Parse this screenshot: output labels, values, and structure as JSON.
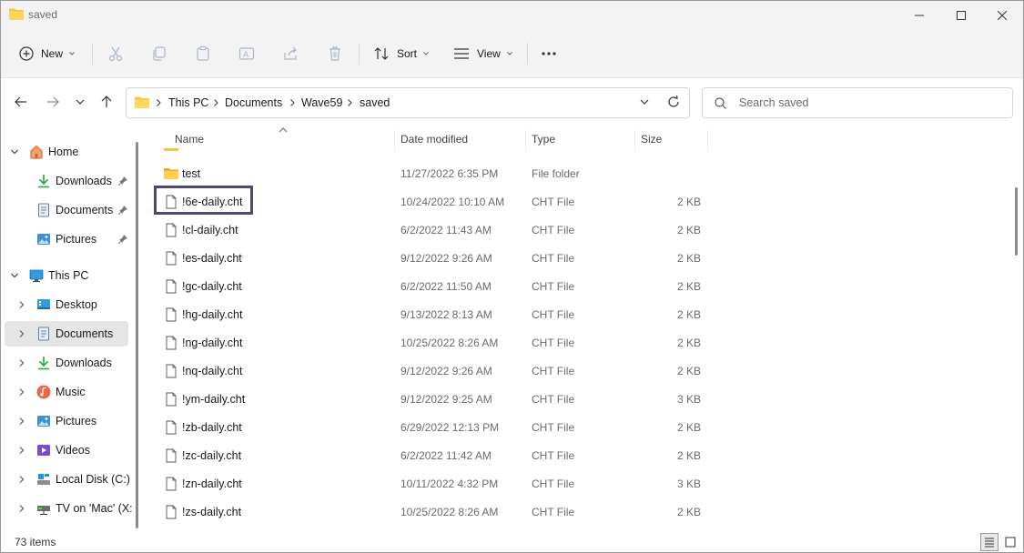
{
  "window": {
    "title": "saved"
  },
  "toolbar": {
    "new_label": "New",
    "sort_label": "Sort",
    "view_label": "View"
  },
  "address": {
    "crumbs": [
      "This PC",
      "Documents",
      "Wave59",
      "saved"
    ]
  },
  "search": {
    "placeholder": "Search saved"
  },
  "nav": {
    "items": [
      {
        "label": "Home"
      },
      {
        "label": "Downloads"
      },
      {
        "label": "Documents"
      },
      {
        "label": "Pictures"
      },
      {
        "label": "This PC"
      },
      {
        "label": "Desktop"
      },
      {
        "label": "Documents"
      },
      {
        "label": "Downloads"
      },
      {
        "label": "Music"
      },
      {
        "label": "Pictures"
      },
      {
        "label": "Videos"
      },
      {
        "label": "Local Disk (C:)"
      },
      {
        "label": "TV on 'Mac' (X:"
      }
    ]
  },
  "columns": {
    "name": "Name",
    "date": "Date modified",
    "type": "Type",
    "size": "Size"
  },
  "files": [
    {
      "name": "test",
      "date": "11/27/2022 6:35 PM",
      "type": "File folder",
      "size": "",
      "icon": "folder-icon"
    },
    {
      "name": "!6e-daily.cht",
      "date": "10/24/2022 10:10 AM",
      "type": "CHT File",
      "size": "2 KB",
      "icon": "file-icon"
    },
    {
      "name": "!cl-daily.cht",
      "date": "6/2/2022 11:43 AM",
      "type": "CHT File",
      "size": "2 KB",
      "icon": "file-icon"
    },
    {
      "name": "!es-daily.cht",
      "date": "9/12/2022 9:26 AM",
      "type": "CHT File",
      "size": "2 KB",
      "icon": "file-icon"
    },
    {
      "name": "!gc-daily.cht",
      "date": "6/2/2022 11:50 AM",
      "type": "CHT File",
      "size": "2 KB",
      "icon": "file-icon"
    },
    {
      "name": "!hg-daily.cht",
      "date": "9/13/2022 8:13 AM",
      "type": "CHT File",
      "size": "2 KB",
      "icon": "file-icon"
    },
    {
      "name": "!ng-daily.cht",
      "date": "10/25/2022 8:26 AM",
      "type": "CHT File",
      "size": "2 KB",
      "icon": "file-icon"
    },
    {
      "name": "!nq-daily.cht",
      "date": "9/12/2022 9:26 AM",
      "type": "CHT File",
      "size": "2 KB",
      "icon": "file-icon"
    },
    {
      "name": "!ym-daily.cht",
      "date": "9/12/2022 9:25 AM",
      "type": "CHT File",
      "size": "3 KB",
      "icon": "file-icon"
    },
    {
      "name": "!zb-daily.cht",
      "date": "6/29/2022 12:13 PM",
      "type": "CHT File",
      "size": "2 KB",
      "icon": "file-icon"
    },
    {
      "name": "!zc-daily.cht",
      "date": "6/2/2022 11:42 AM",
      "type": "CHT File",
      "size": "2 KB",
      "icon": "file-icon"
    },
    {
      "name": "!zn-daily.cht",
      "date": "10/11/2022 4:32 PM",
      "type": "CHT File",
      "size": "3 KB",
      "icon": "file-icon"
    },
    {
      "name": "!zs-daily.cht",
      "date": "10/25/2022 8:26 AM",
      "type": "CHT File",
      "size": "2 KB",
      "icon": "file-icon"
    }
  ],
  "status": {
    "item_count": "73 items"
  },
  "colors": {
    "folder": "#f4c542",
    "focus_outline": "#4d4a6e",
    "selected_nav": "#e5e5e5",
    "accent": "#0067c0"
  }
}
